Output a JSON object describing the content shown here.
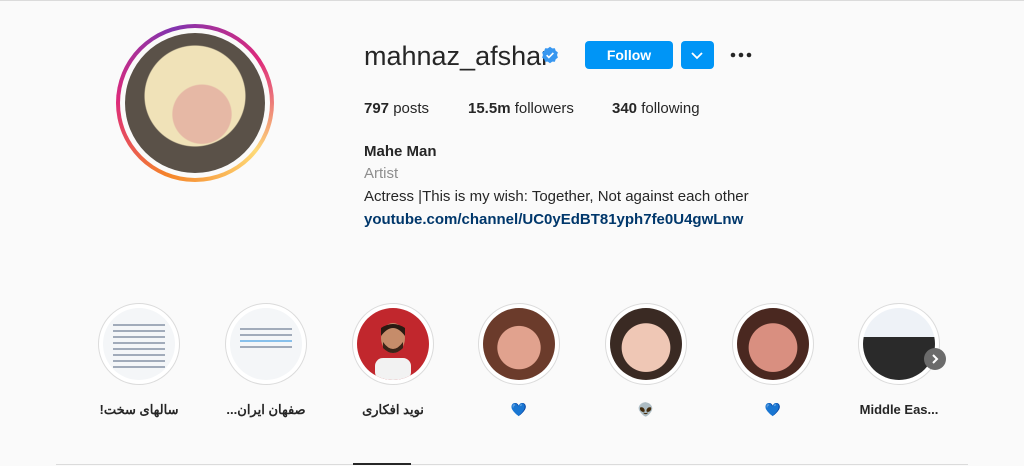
{
  "profile": {
    "username": "mahnaz_afshar",
    "follow_label": "Follow",
    "stats": {
      "posts_count": "797",
      "posts_label": "posts",
      "followers_count": "15.5m",
      "followers_label": "followers",
      "following_count": "340",
      "following_label": "following"
    },
    "bio": {
      "name": "Mahe Man",
      "category": "Artist",
      "text": "Actress |This is my wish: Together, Not against each other",
      "link": "youtube.com/channel/UC0yEdBT81yph7fe0U4gwLnw"
    }
  },
  "highlights": [
    {
      "label": "!سالهای سخت"
    },
    {
      "label": "...صفهان ایران"
    },
    {
      "label": "نوید افکاری"
    },
    {
      "label": "💙"
    },
    {
      "label": "👽"
    },
    {
      "label": "💙"
    },
    {
      "label": "Middle Eas..."
    }
  ],
  "colors": {
    "accent": "#0095f6",
    "link": "#00376b",
    "verified": "#3897f0"
  },
  "icons": {
    "verified": "verified-badge-icon",
    "dropdown": "chevron-down-icon",
    "more": "more-options-icon",
    "next": "chevron-right-icon"
  }
}
